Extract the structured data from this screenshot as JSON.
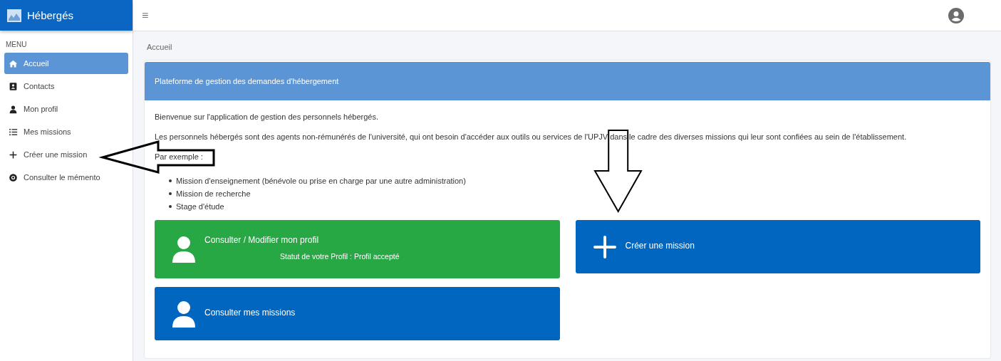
{
  "brand": {
    "title": "Hébergés"
  },
  "sidebar": {
    "heading": "MENU",
    "items": [
      {
        "label": "Accueil",
        "selected": true
      },
      {
        "label": "Contacts",
        "selected": false
      },
      {
        "label": "Mon profil",
        "selected": false
      },
      {
        "label": "Mes missions",
        "selected": false
      },
      {
        "label": "Créer une mission",
        "selected": false
      },
      {
        "label": "Consulter le mémento",
        "selected": false
      }
    ]
  },
  "topbar": {
    "menu_glyph": "≡"
  },
  "breadcrumb": "Accueil",
  "card": {
    "title": "Plateforme de gestion des demandes d'hébergement",
    "paragraphs": [
      "Bienvenue sur l'application de gestion des personnels hébergés.",
      "Les personnels hébergés sont des agents non-rémunérés de l'université, qui ont besoin d'accéder aux outils ou services de l'UPJV dans le cadre des diverses missions qui leur sont confiées au sein de l'établissement."
    ],
    "examples_label": "Par exemple :",
    "examples": [
      "Mission d'enseignement (bénévole ou prise en charge par une autre administration)",
      "Mission de recherche",
      "Stage d'étude"
    ],
    "tiles": [
      {
        "kind": "person",
        "color": "#28a745",
        "title": "Consulter / Modifier mon profil",
        "status": "Statut de votre Profil : Profil accepté"
      },
      {
        "kind": "plus",
        "color": "#0066c0",
        "title": "Créer une mission"
      },
      {
        "kind": "person",
        "color": "#0066c0",
        "title": "Consulter mes missions"
      }
    ]
  }
}
